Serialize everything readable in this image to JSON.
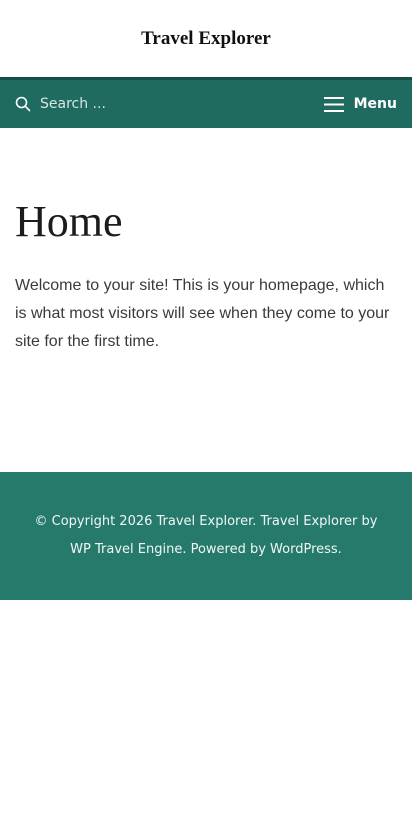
{
  "header": {
    "site_title": "Travel Explorer"
  },
  "nav": {
    "search_placeholder": "Search ...",
    "search_icon": "search-icon",
    "menu_icon": "hamburger-icon",
    "menu_label": "Menu"
  },
  "main": {
    "title": "Home",
    "body": "Welcome to your site! This is your homepage, which is what most visitors will see when they come to your site for the first time."
  },
  "footer": {
    "copyright": "© Copyright 2026 Travel Explorer. Travel Explorer by WP Travel Engine. Powered by WordPress."
  },
  "colors": {
    "nav_background": "#1f6b5f",
    "footer_background": "#267a6c",
    "title_text": "#1c1c1c",
    "body_text": "#3a3a3a"
  }
}
